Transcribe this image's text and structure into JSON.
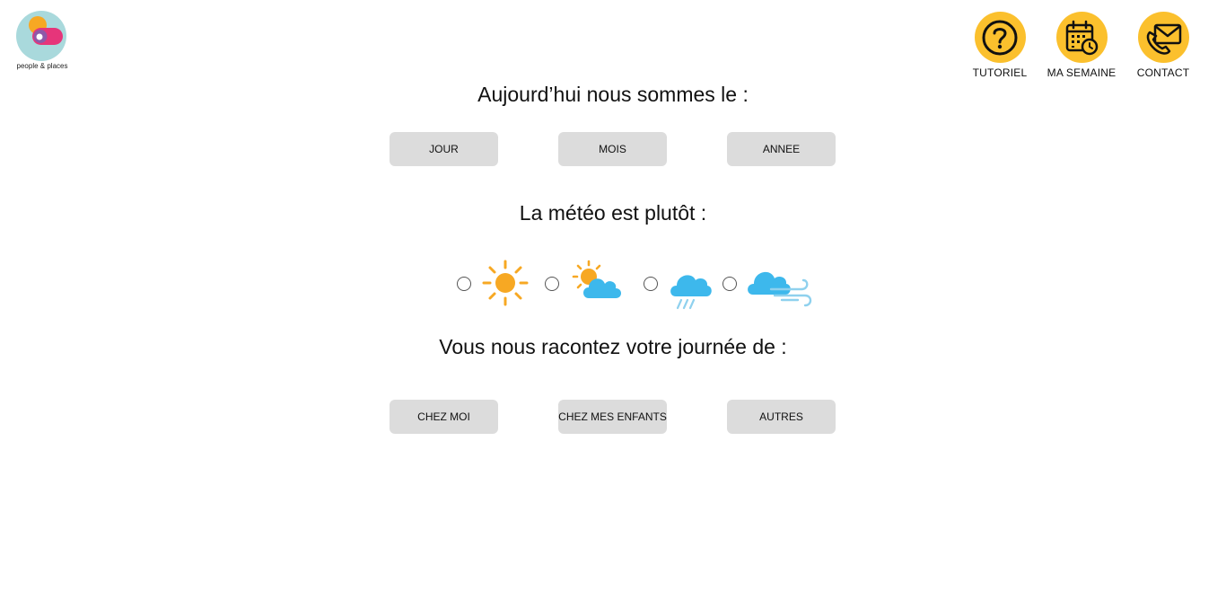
{
  "brand": {
    "logo_text": "people & places",
    "colors": {
      "orange": "#F7A823",
      "pink": "#E6357A",
      "purple": "#8E59A8",
      "teal": "#A9D9DC"
    }
  },
  "nav": [
    {
      "label": "TUTORIEL",
      "icon": "question-icon"
    },
    {
      "label": "MA SEMAINE",
      "icon": "calendar-clock-icon"
    },
    {
      "label": "CONTACT",
      "icon": "envelope-phone-icon"
    }
  ],
  "accent_color": "#FBC02D",
  "date_section": {
    "heading": "Aujourd’hui nous sommes le :",
    "buttons": [
      "JOUR",
      "MOIS",
      "ANNEE"
    ]
  },
  "weather_section": {
    "heading": "La météo est plutôt :",
    "options": [
      {
        "icon": "sun-icon",
        "selected": false
      },
      {
        "icon": "sun-cloud-icon",
        "selected": false
      },
      {
        "icon": "rain-cloud-icon",
        "selected": false
      },
      {
        "icon": "wind-cloud-icon",
        "selected": false
      }
    ]
  },
  "story_section": {
    "heading": "Vous nous racontez votre journée de :",
    "buttons": [
      "CHEZ MOI",
      "CHEZ MES ENFANTS",
      "AUTRES"
    ]
  }
}
